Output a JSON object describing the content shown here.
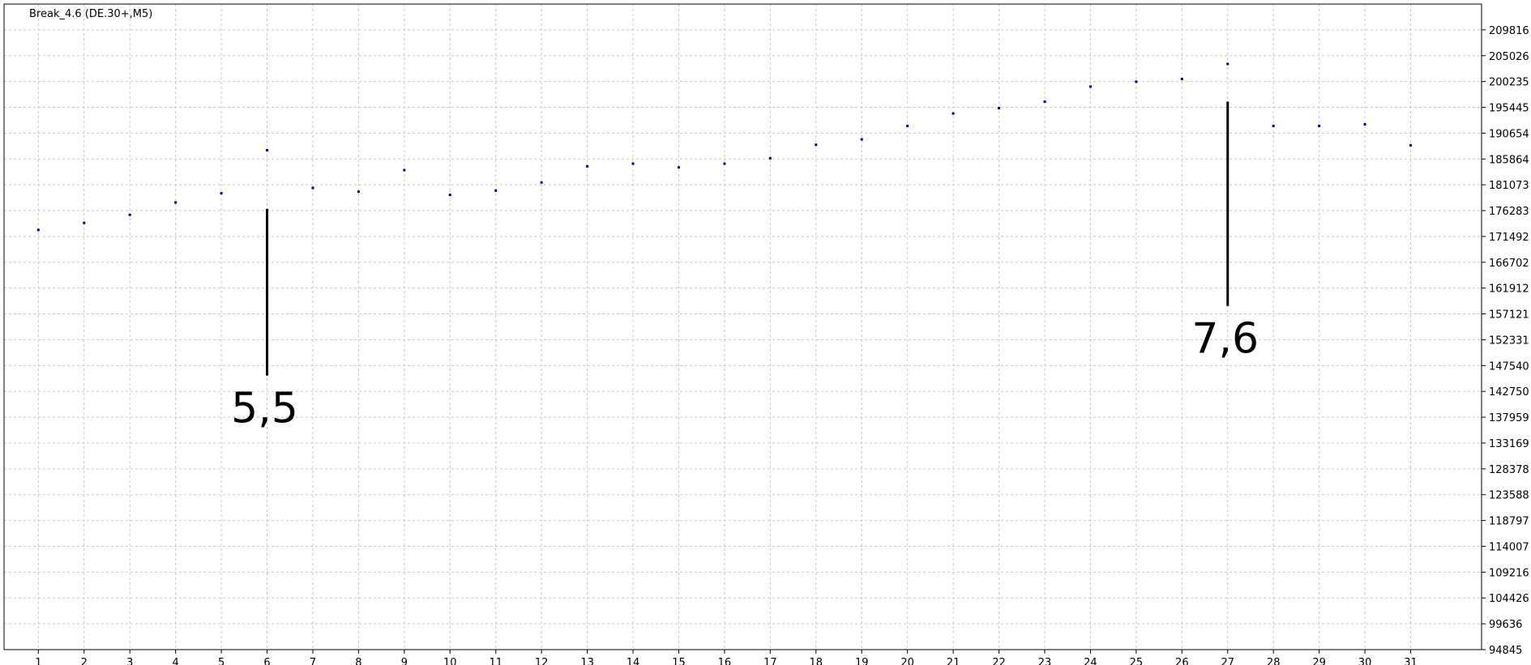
{
  "chart_data": {
    "type": "scatter",
    "title": "Break_4.6 (DE.30+,M5)",
    "x": [
      1,
      2,
      3,
      4,
      5,
      6,
      7,
      8,
      9,
      10,
      11,
      12,
      13,
      14,
      15,
      16,
      17,
      18,
      19,
      20,
      21,
      22,
      23,
      24,
      25,
      26,
      27,
      28,
      29,
      30,
      31
    ],
    "values": [
      172700,
      174000,
      175500,
      177800,
      179500,
      187500,
      180500,
      179800,
      183800,
      179200,
      180000,
      181500,
      184500,
      185000,
      184300,
      185000,
      186000,
      188500,
      189500,
      192000,
      194300,
      195300,
      196500,
      199300,
      200200,
      200700,
      203500,
      192000,
      192000,
      192300,
      188400
    ],
    "xlim": [
      0.25,
      32.55
    ],
    "ylim": [
      94845,
      214606
    ],
    "ytick_labels": [
      "209816",
      "205026",
      "200235",
      "195445",
      "190654",
      "185864",
      "181073",
      "176283",
      "171492",
      "166702",
      "161912",
      "157121",
      "152331",
      "147540",
      "142750",
      "137959",
      "133169",
      "128378",
      "123588",
      "118797",
      "114007",
      "109216",
      "104426",
      "99636",
      "94845"
    ],
    "ytick_values": [
      209816,
      205026,
      200235,
      195445,
      190654,
      185864,
      181073,
      176283,
      171492,
      166702,
      161912,
      157121,
      152331,
      147540,
      142750,
      137959,
      133169,
      128378,
      123588,
      118797,
      114007,
      109216,
      104426,
      99636,
      94845
    ],
    "grid": true,
    "point_color": "#00008b",
    "annotations": [
      {
        "label": "5,5",
        "x": 6,
        "y_top": 176600,
        "y_bottom": 145700
      },
      {
        "label": "7,6",
        "x": 27,
        "y_top": 196500,
        "y_bottom": 158600
      }
    ]
  }
}
